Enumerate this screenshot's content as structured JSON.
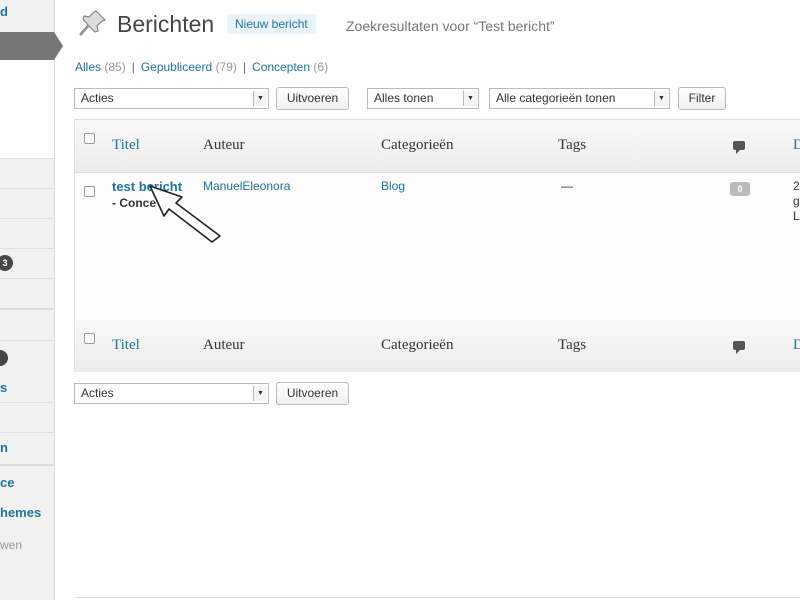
{
  "sidebar": {
    "items": [
      {
        "label": "d"
      },
      {
        "label": "s"
      },
      {
        "label": "n"
      },
      {
        "label": "ce"
      },
      {
        "label": "hemes"
      },
      {
        "label": "wen"
      }
    ],
    "badges": [
      {
        "count": "3"
      },
      {
        "count": ""
      }
    ]
  },
  "header": {
    "title": "Berichten",
    "new_button": "Nieuw bericht",
    "subtitle": "Zoekresultaten voor “Test bericht”"
  },
  "views": {
    "all_label": "Alles",
    "all_count": "(85)",
    "published_label": "Gepubliceerd",
    "published_count": "(79)",
    "drafts_label": "Concepten",
    "drafts_count": "(6)",
    "separator": "|"
  },
  "filters": {
    "bulk_actions": "Acties",
    "apply": "Uitvoeren",
    "dates": "Alles tonen",
    "categories": "Alle categorieën tonen",
    "filter": "Filter"
  },
  "table": {
    "columns": {
      "title": "Titel",
      "author": "Auteur",
      "categories": "Categorieën",
      "tags": "Tags",
      "date": "D"
    },
    "rows": [
      {
        "title": "test bericht",
        "state": "- Conce",
        "author": "ManuelEleonora",
        "category": "Blog",
        "tags": "—",
        "comments": "0",
        "date_line1": "2",
        "date_line2": "g",
        "date_line3": "L"
      }
    ]
  },
  "bottom": {
    "bulk_actions": "Acties",
    "apply": "Uitvoeren"
  },
  "colors": {
    "link": "#21759b",
    "sidebar_bg": "#f1f1f1",
    "active_menu": "#777777"
  }
}
